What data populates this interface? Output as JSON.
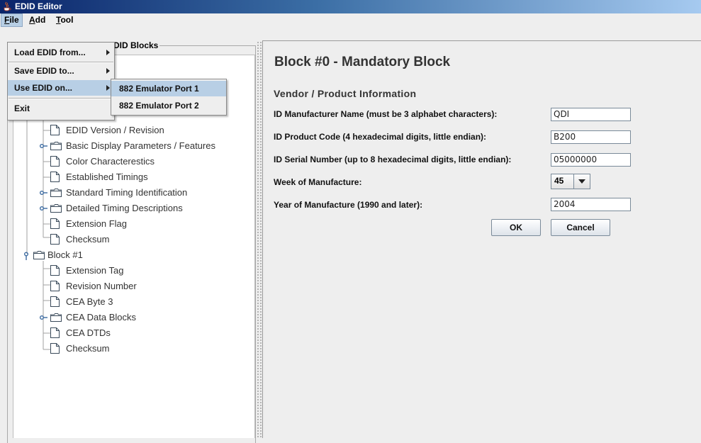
{
  "window": {
    "title": "EDID Editor"
  },
  "menubar": [
    {
      "label": "File",
      "mnemonic": "F",
      "rest": "ile"
    },
    {
      "label": "Add",
      "mnemonic": "A",
      "rest": "dd"
    },
    {
      "label": "Tool",
      "mnemonic": "T",
      "rest": "ool"
    }
  ],
  "file_menu": {
    "items": [
      "Load EDID from...",
      "Save EDID to...",
      "Use EDID on...",
      "Exit"
    ]
  },
  "submenu": {
    "items": [
      "882 Emulator Port 1",
      "882 Emulator Port 2"
    ]
  },
  "left_panel": {
    "legend_fragment": "DID Blocks"
  },
  "tree": [
    {
      "label": "EDID Version / Revision"
    },
    {
      "label": "Basic Display Parameters / Features"
    },
    {
      "label": "Color Characterestics"
    },
    {
      "label": "Established Timings"
    },
    {
      "label": "Standard Timing Identification"
    },
    {
      "label": "Detailed Timing Descriptions"
    },
    {
      "label": "Extension Flag"
    },
    {
      "label": "Checksum"
    },
    {
      "label": "Block #1"
    },
    {
      "label": "Extension Tag"
    },
    {
      "label": "Revision Number"
    },
    {
      "label": "CEA Byte 3"
    },
    {
      "label": "CEA Data Blocks"
    },
    {
      "label": "CEA DTDs"
    },
    {
      "label": "Checksum"
    }
  ],
  "main": {
    "block_title": "Block #0 - Mandatory Block",
    "section_title": "Vendor / Product Information",
    "fields": [
      {
        "label": "ID Manufacturer Name (must be 3 alphabet characters):",
        "value": "QDI"
      },
      {
        "label": "ID Product Code (4 hexadecimal digits, little endian):",
        "value": "B200"
      },
      {
        "label": "ID Serial Number (up to 8 hexadecimal digits, little endian):",
        "value": "05000000"
      },
      {
        "label": "Week of Manufacture:",
        "value": "45"
      },
      {
        "label": "Year of Manufacture (1990 and later):",
        "value": "2004"
      }
    ],
    "ok_label": "OK",
    "cancel_label": "Cancel"
  }
}
